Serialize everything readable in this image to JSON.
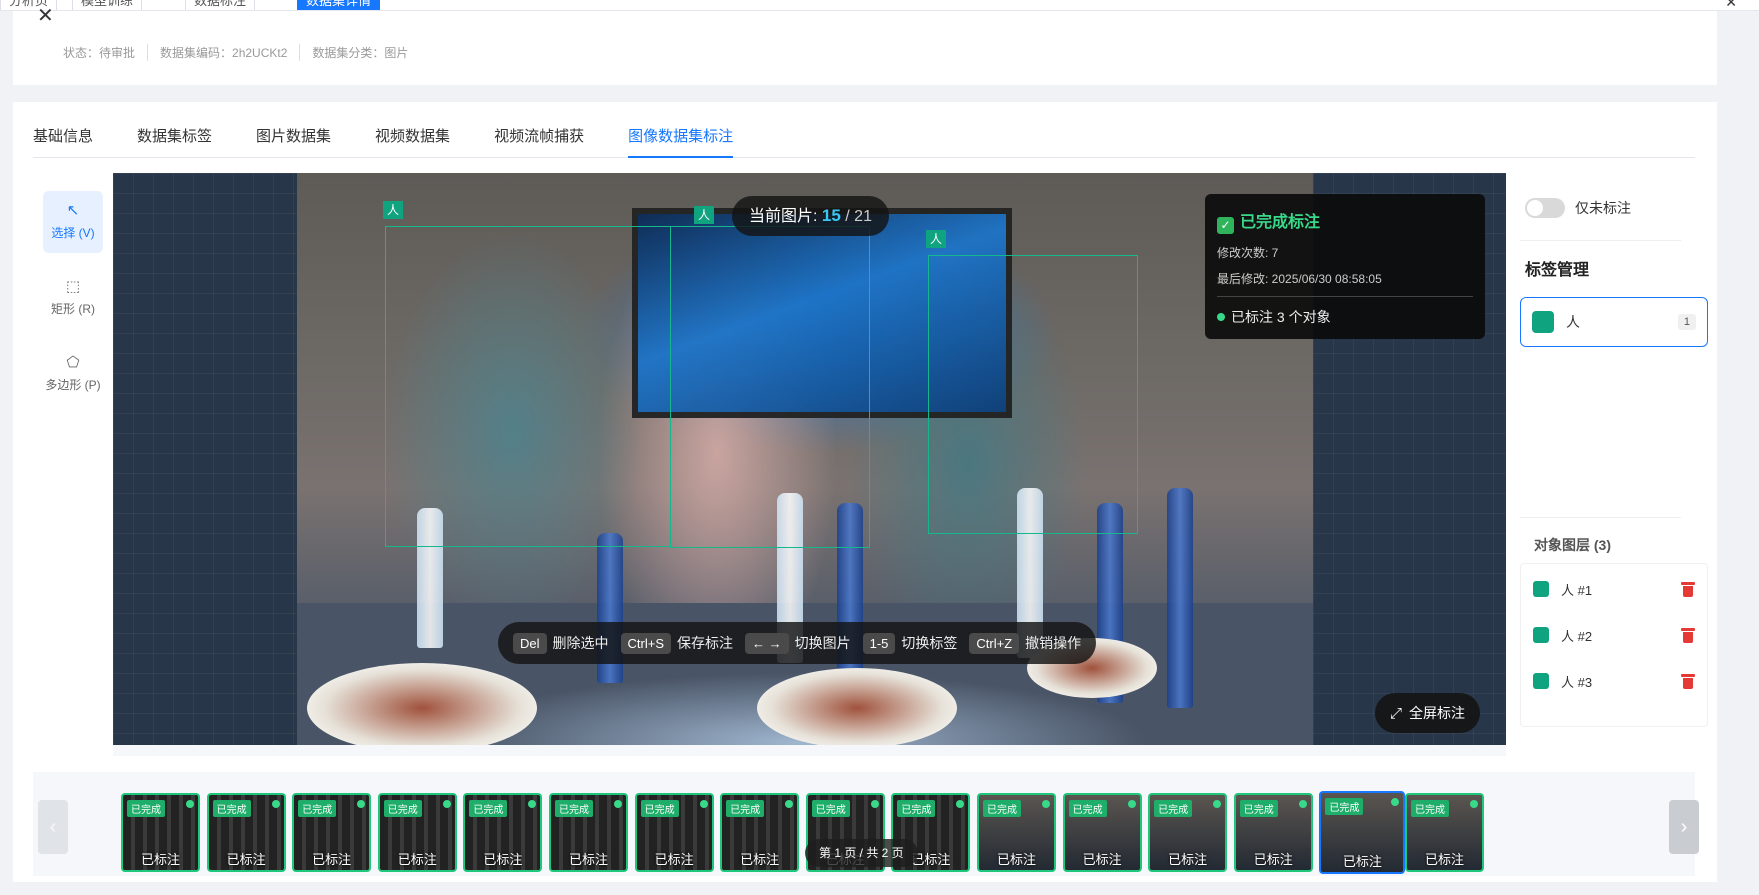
{
  "top_tabs": [
    {
      "label": "分析页",
      "active": false
    },
    {
      "label": "模型训练",
      "active": false
    },
    {
      "label": "数据标注",
      "active": false
    },
    {
      "label": "数据集详情",
      "active": true
    }
  ],
  "header": {
    "status": "状态：待审批",
    "code": "数据集编码：2h2UCKt2",
    "category": "数据集分类：图片"
  },
  "tabs": [
    "基础信息",
    "数据集标签",
    "图片数据集",
    "视频数据集",
    "视频流帧捕获",
    "图像数据集标注"
  ],
  "active_tab": "图像数据集标注",
  "tools": [
    {
      "label": "选择 (V)",
      "icon": "cursor-icon",
      "active": true
    },
    {
      "label": "矩形 (R)",
      "icon": "rectangle-icon",
      "active": false
    },
    {
      "label": "多边形 (P)",
      "icon": "polygon-icon",
      "active": false
    }
  ],
  "canvas": {
    "current_label": "当前图片:",
    "current_index": "15",
    "total": "/ 21",
    "boxes": [
      {
        "label": "人"
      },
      {
        "label": "人"
      },
      {
        "label": "人"
      }
    ]
  },
  "status_panel": {
    "title": "已完成标注",
    "edits": "修改次数: 7",
    "last_modified": "最后修改: 2025/06/30 08:58:05",
    "count": "已标注 3 个对象"
  },
  "shortcuts": [
    {
      "key": "Del",
      "label": "删除选中"
    },
    {
      "key": "Ctrl+S",
      "label": "保存标注"
    },
    {
      "key": "← →",
      "label": "切换图片"
    },
    {
      "key": "1-5",
      "label": "切换标签"
    },
    {
      "key": "Ctrl+Z",
      "label": "撤销操作"
    }
  ],
  "fullscreen_label": "全屏标注",
  "right_panel": {
    "toggle_label": "仅未标注",
    "tag_title": "标签管理",
    "tag": {
      "name": "人",
      "count": "1",
      "color": "#10a37f"
    },
    "layers_title": "对象图层 (3)",
    "layers": [
      "人 #1",
      "人 #2",
      "人 #3"
    ]
  },
  "thumbnails": {
    "done_badge": "已完成",
    "label": "已标注",
    "items": [
      "dark",
      "dark",
      "dark",
      "dark",
      "dark",
      "dark",
      "dark",
      "dark",
      "dark",
      "dark",
      "photo",
      "photo",
      "photo",
      "photo",
      "photo-current",
      "photo"
    ]
  },
  "pager": "第 1 页 / 共 2 页",
  "colors": {
    "accent": "#1677ff",
    "box": "#14b88c",
    "done": "#1fae6a",
    "delete": "#e53935"
  }
}
